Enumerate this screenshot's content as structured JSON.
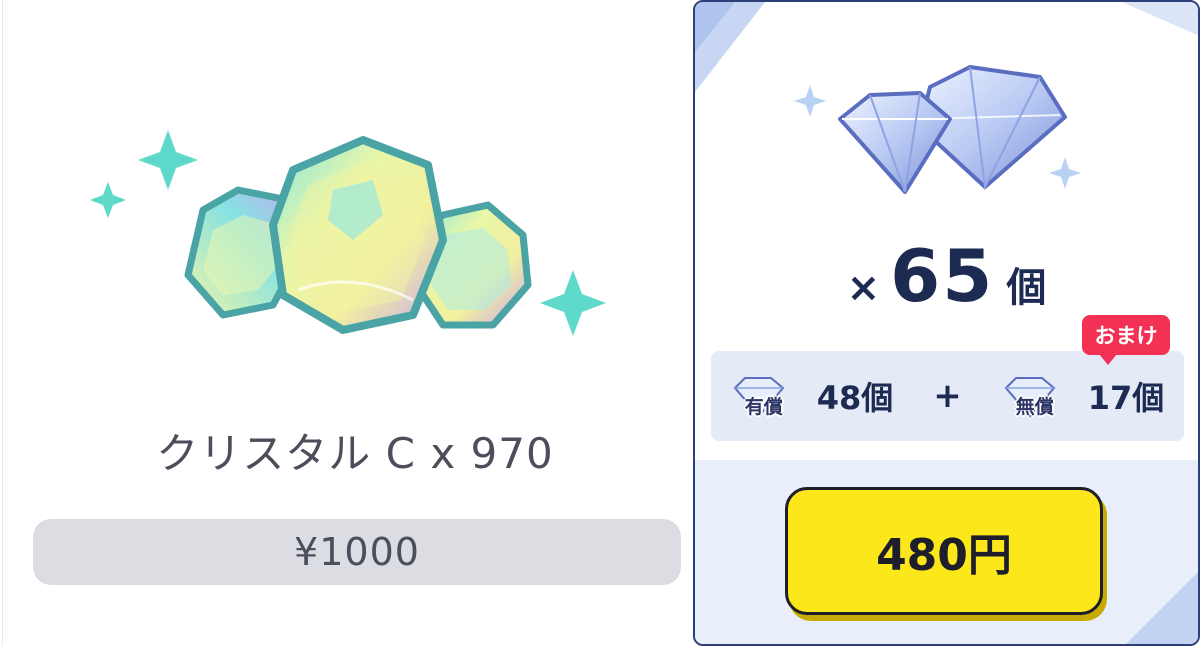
{
  "left_item": {
    "title": "クリスタル C x 970",
    "price": "¥1000",
    "colors": {
      "sparkle": "#5fd9c9",
      "gem_outline": "#3f9e9d",
      "pill": "#dcdce3"
    }
  },
  "right_item": {
    "quantity_prefix": "×",
    "quantity": "65",
    "quantity_unit": "個",
    "bonus_badge": "おまけ",
    "paid_label": "有償",
    "paid_count": "48個",
    "plus": "+",
    "free_label": "無償",
    "free_count": "17個",
    "price_button": "480円",
    "colors": {
      "border": "#2d3f7a",
      "button": "#fbe71a",
      "badge": "#f23155",
      "text": "#1d2a52"
    }
  },
  "icons": [
    "crystal-cluster-icon",
    "sparkle-icon",
    "diamond-pair-icon",
    "mini-diamond-icon"
  ]
}
